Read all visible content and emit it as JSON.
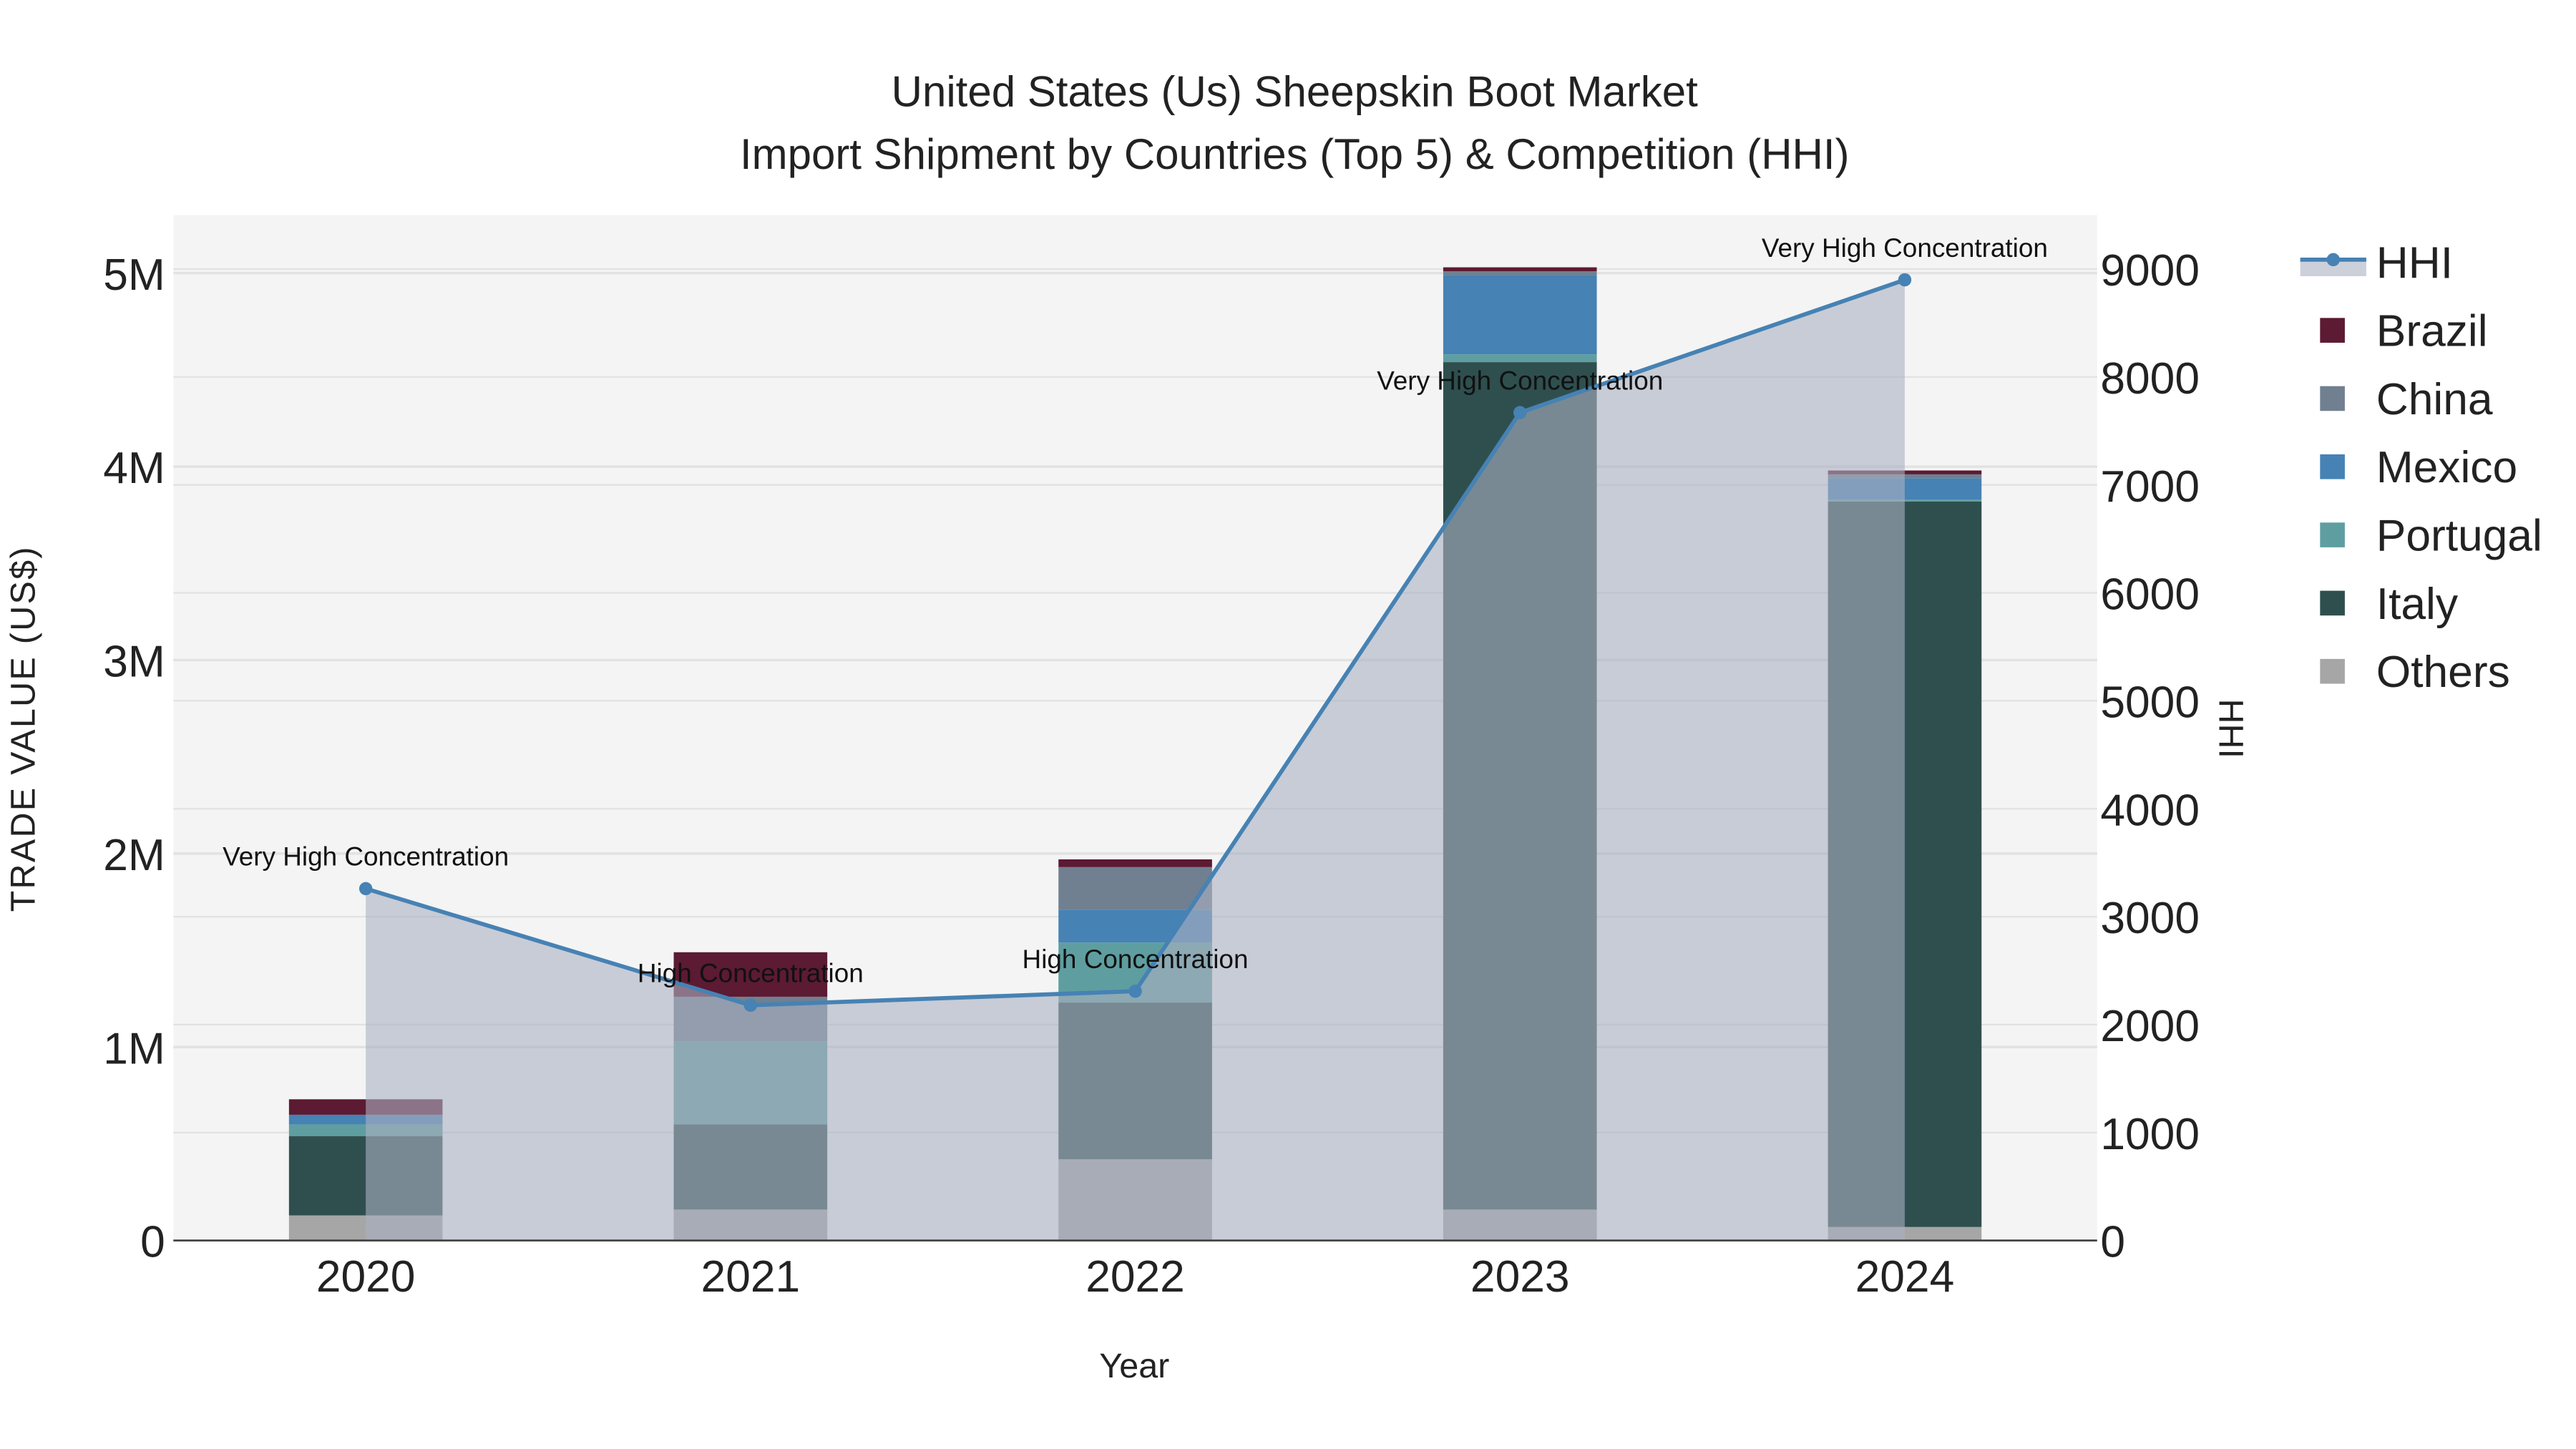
{
  "chart_data": {
    "type": "bar",
    "title": "United States (Us) Sheepskin Boot Market",
    "subtitle": "Import Shipment by Countries (Top 5) & Competition (HHI)",
    "xlabel": "Year",
    "ylabel": "TRADE VALUE (US$)",
    "y2label": "HHI",
    "categories": [
      "2020",
      "2021",
      "2022",
      "2023",
      "2024"
    ],
    "ylim": [
      0,
      5300000
    ],
    "y2lim": [
      0,
      9500
    ],
    "yticks": [
      {
        "v": 0,
        "t": "0"
      },
      {
        "v": 1000000,
        "t": "1M"
      },
      {
        "v": 2000000,
        "t": "2M"
      },
      {
        "v": 3000000,
        "t": "3M"
      },
      {
        "v": 4000000,
        "t": "4M"
      },
      {
        "v": 5000000,
        "t": "5M"
      }
    ],
    "y2ticks": [
      0,
      1000,
      2000,
      3000,
      4000,
      5000,
      6000,
      7000,
      8000,
      9000
    ],
    "series": [
      {
        "name": "Others",
        "color": "#a6a6a6",
        "values": [
          130000,
          160000,
          420000,
          160000,
          70000
        ]
      },
      {
        "name": "Italy",
        "color": "#2f4f4f",
        "values": [
          410000,
          440000,
          810000,
          4380000,
          3750000
        ]
      },
      {
        "name": "Portugal",
        "color": "#5f9ea0",
        "values": [
          60000,
          430000,
          310000,
          40000,
          10000
        ]
      },
      {
        "name": "Mexico",
        "color": "#4682b4",
        "values": [
          50000,
          0,
          170000,
          410000,
          110000
        ]
      },
      {
        "name": "China",
        "color": "#708090",
        "values": [
          0,
          230000,
          220000,
          20000,
          20000
        ]
      },
      {
        "name": "Brazil",
        "color": "#5c1a33",
        "values": [
          80000,
          230000,
          40000,
          20000,
          20000
        ]
      }
    ],
    "hhi": {
      "name": "HHI",
      "color": "#4682b4",
      "values": [
        3260,
        2180,
        2310,
        7670,
        8900
      ],
      "labels": [
        "Very High Concentration",
        "High Concentration",
        "High Concentration",
        "Very High Concentration",
        "Very High Concentration"
      ]
    },
    "legend_order": [
      "HHI",
      "Brazil",
      "China",
      "Mexico",
      "Portugal",
      "Italy",
      "Others"
    ],
    "legend_position": "right",
    "grid": true
  }
}
